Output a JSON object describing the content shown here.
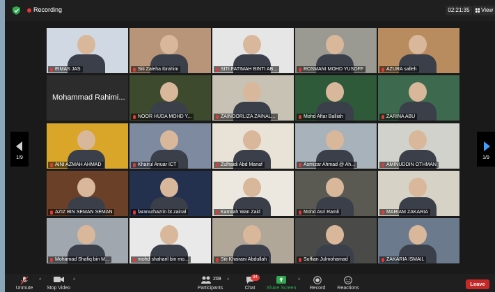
{
  "topbar": {
    "recording_label": "Recording",
    "timer": "02:21:35",
    "view_label": "View"
  },
  "pager": {
    "left_page": "1/9",
    "right_page": "1/9"
  },
  "tiles": [
    {
      "name": "EIMAS JAS",
      "bg": "#cfd8e3"
    },
    {
      "name": "Siti Zaleha Ibrahim",
      "bg": "#b89478"
    },
    {
      "name": "SITI FATIMAH BINTI AB...",
      "bg": "#e6e6e6"
    },
    {
      "name": "ROSMANI MOHD YUSOFF",
      "bg": "#9a9a92"
    },
    {
      "name": "AZURA salleh",
      "bg": "#b88c5e"
    },
    {
      "name": "",
      "big": "Mohammad Rahimi...",
      "bg": "#2c2c2c"
    },
    {
      "name": "NOOR HUDA MOHD Y...",
      "bg": "#3e4a2e"
    },
    {
      "name": "ZAINOORLIZA ZAINAL...",
      "bg": "#c7c2b4"
    },
    {
      "name": "Mohd Aftar Balliah",
      "bg": "#2f5a3a"
    },
    {
      "name": "ZARINA ABU",
      "bg": "#3d6a4e"
    },
    {
      "name": "AINI AZMAH AHMAD",
      "bg": "#d9a62a"
    },
    {
      "name": "Khairul Anuar ICT",
      "bg": "#7d8aa0"
    },
    {
      "name": "Zulhaidi Abd Manaf",
      "bg": "#e8e3d6"
    },
    {
      "name": "Asmizar Ahmad @ Ah...",
      "bg": "#a8b2ba"
    },
    {
      "name": "AMINUDDIN OTHMAN",
      "bg": "#d2d2cc"
    },
    {
      "name": "AZIZ BIN SEMAN SEMAN",
      "bg": "#6a4028"
    },
    {
      "name": "faranurhazrin bt zainal",
      "bg": "#23304e"
    },
    {
      "name": "Kamilah Wan Zaid",
      "bg": "#ece8e0"
    },
    {
      "name": "Mohd Asri Ramli",
      "bg": "#5a5a52"
    },
    {
      "name": "MARIAM ZAKARIA",
      "bg": "#d6d2c6"
    },
    {
      "name": "Mohamad Shafiq bin M...",
      "bg": "#a0a7ae"
    },
    {
      "name": "mohd shaharil bin mo...",
      "bg": "#e9e9e9"
    },
    {
      "name": "Siti Khairani Abdullah",
      "bg": "#b0a798"
    },
    {
      "name": "Suffian Julmohamad",
      "bg": "#4a4a48"
    },
    {
      "name": "ZAKARIA ISMAIL",
      "bg": "#6b7a8c"
    }
  ],
  "toolbar": {
    "unmute": "Unmute",
    "stop_video": "Stop Video",
    "participants": "Participants",
    "participants_count": "208",
    "chat": "Chat",
    "chat_badge": "34",
    "share_screen": "Share Screen",
    "record": "Record",
    "reactions": "Reactions",
    "leave": "Leave"
  },
  "colors": {
    "accent_green": "#2fa84f",
    "leave_red": "#c62828",
    "active_border": "#e8e23a",
    "pager_arrow": "#3ea0ff"
  }
}
